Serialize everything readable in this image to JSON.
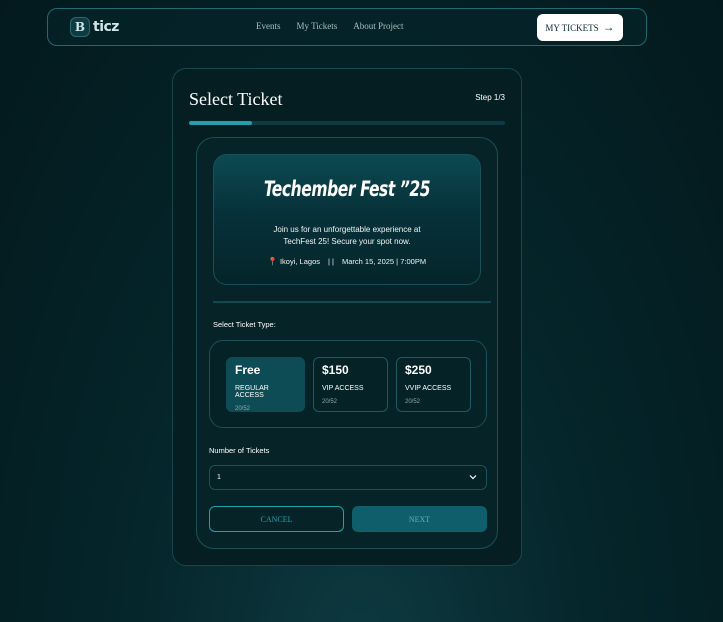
{
  "nav": {
    "logo_mark": "B",
    "logo_text": "ticz",
    "links": [
      "Events",
      "My Tickets",
      "About Project"
    ],
    "cta_label": "MY TICKETS",
    "cta_arrow": "→"
  },
  "card": {
    "title": "Select Ticket",
    "step": "Step 1/3",
    "progress": 0.2
  },
  "event": {
    "title": "Techember Fest ”25",
    "description": "Join us for an unforgettable experience at TechFest 25! Secure your spot now.",
    "location": "Ikoyi, Lagos",
    "separator": "| |",
    "datetime": "March 15, 2025 | 7:00PM"
  },
  "ticket_type_label": "Select Ticket Type:",
  "ticket_types": [
    {
      "price": "Free",
      "name": "REGULAR ACCESS",
      "availability": "20/52",
      "selected": true
    },
    {
      "price": "$150",
      "name": "VIP ACCESS",
      "availability": "20/52",
      "selected": false
    },
    {
      "price": "$250",
      "name": "VVIP ACCESS",
      "availability": "20/52",
      "selected": false
    }
  ],
  "quantity": {
    "label": "Number of Tickets",
    "value": "1"
  },
  "actions": {
    "cancel": "CANCEL",
    "next": "NEXT"
  },
  "colors": {
    "accent": "#24a0ad",
    "background": "#041e22",
    "selected_type": "#0e4c55",
    "pin": "#e53935"
  }
}
